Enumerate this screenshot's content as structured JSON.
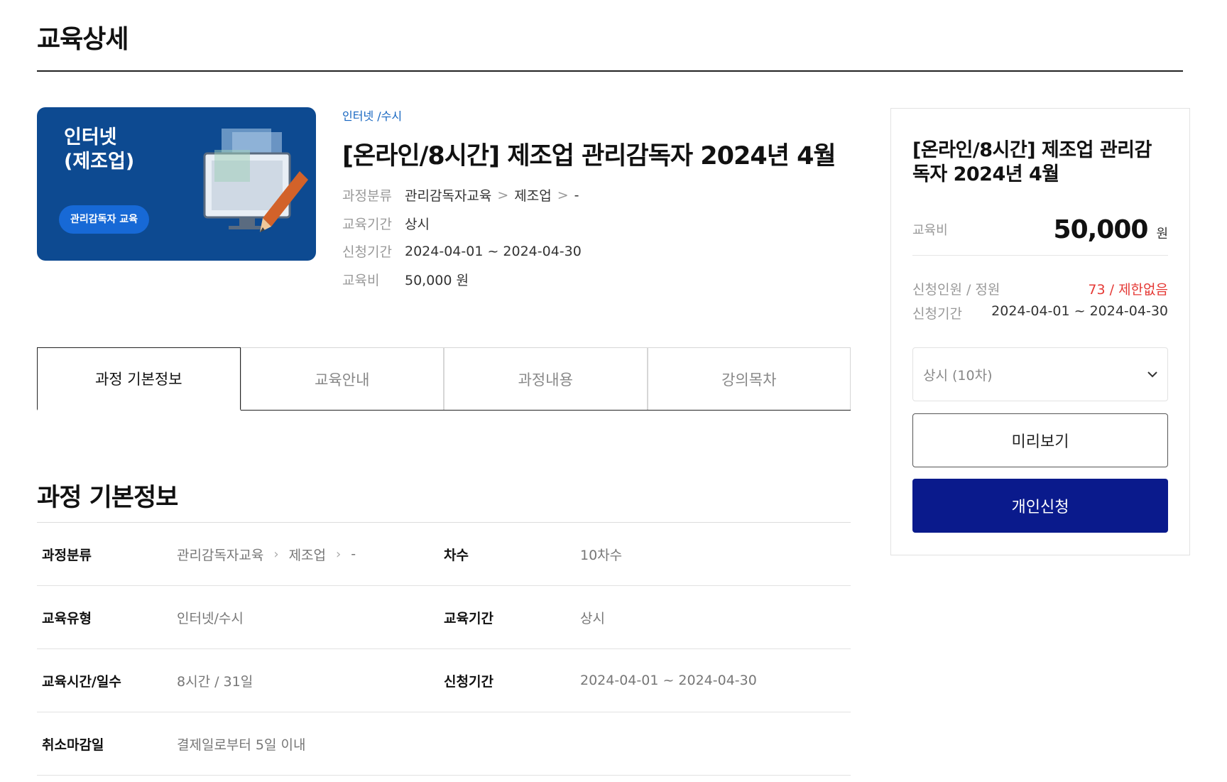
{
  "page": {
    "title": "교육상세"
  },
  "thumbnail": {
    "title": "인터넷\n(제조업)",
    "badge": "관리감독자 교육"
  },
  "course": {
    "category_tag": "인터넷 /수시",
    "title": "[온라인/8시간] 제조업 관리감독자 2024년 4월",
    "info": {
      "classification_label": "과정분류",
      "classification": [
        "관리감독자교육",
        "제조업",
        "-"
      ],
      "period_label": "교육기간",
      "period": "상시",
      "apply_label": "신청기간",
      "apply": "2024-04-01 ~ 2024-04-30",
      "fee_label": "교육비",
      "fee": "50,000 원"
    }
  },
  "tabs": [
    "과정 기본정보",
    "교육안내",
    "과정내용",
    "강의목차"
  ],
  "section": {
    "title": "과정 기본정보",
    "rows": [
      {
        "k1": "과정분류",
        "v1": [
          "관리감독자교육",
          "제조업",
          "-"
        ],
        "k2": "차수",
        "v2": "10차수"
      },
      {
        "k1": "교육유형",
        "v1": "인터넷/수시",
        "k2": "교육기간",
        "v2": "상시"
      },
      {
        "k1": "교육시간/일수",
        "v1": "8시간 / 31일",
        "k2": "신청기간",
        "v2": "2024-04-01 ~ 2024-04-30"
      },
      {
        "k1": "취소마감일",
        "v1": "결제일로부터 5일 이내"
      }
    ]
  },
  "panel": {
    "title": "[온라인/8시간] 제조업 관리감독자 2024년 4월",
    "fee_label": "교육비",
    "fee_amount": "50,000",
    "fee_unit": "원",
    "capacity_label": "신청인원 / 정원",
    "capacity_value": "73 / 제한없음",
    "apply_label": "신청기간",
    "apply_value": "2024-04-01 ~ 2024-04-30",
    "select_value": "상시 (10차)",
    "preview_button": "미리보기",
    "apply_button": "개인신청"
  },
  "colors": {
    "accent": "#0a1a8c",
    "thumb_bg": "#0d4a91",
    "tag": "#1565c0",
    "capacity": "#e53935"
  }
}
